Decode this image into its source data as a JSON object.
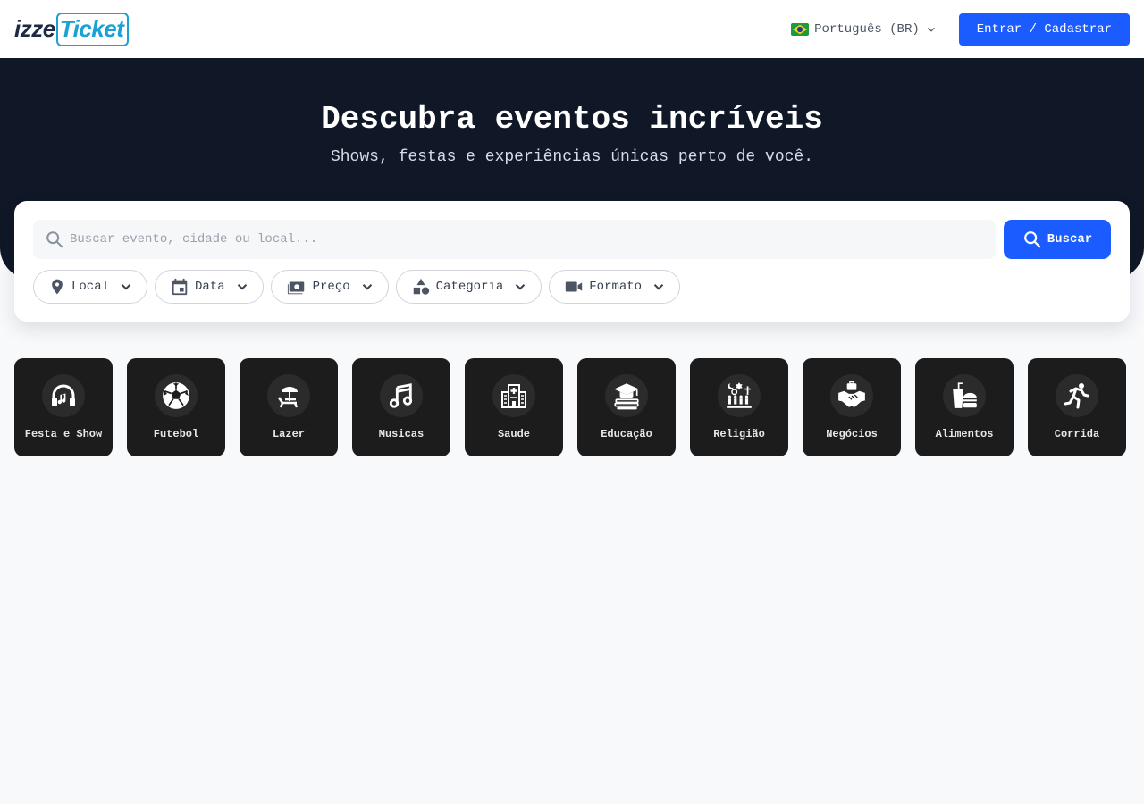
{
  "header": {
    "logo_left": "izze",
    "logo_right": "Ticket",
    "language": "Português (BR)",
    "login_button": "Entrar / Cadastrar"
  },
  "hero": {
    "title": "Descubra eventos incríveis",
    "subtitle": "Shows, festas e experiências únicas perto de você."
  },
  "search": {
    "placeholder": "Buscar evento, cidade ou local...",
    "button": "Buscar"
  },
  "filters": [
    {
      "label": "Local",
      "icon": "map-pin-icon"
    },
    {
      "label": "Data",
      "icon": "calendar-icon"
    },
    {
      "label": "Preço",
      "icon": "money-icon"
    },
    {
      "label": "Categoria",
      "icon": "shapes-icon"
    },
    {
      "label": "Formato",
      "icon": "video-camera-icon"
    }
  ],
  "categories": [
    {
      "label": "Festa e Show",
      "icon": "headphones-icon"
    },
    {
      "label": "Futebol",
      "icon": "soccer-ball-icon"
    },
    {
      "label": "Lazer",
      "icon": "beach-chair-icon"
    },
    {
      "label": "Musicas",
      "icon": "music-note-icon"
    },
    {
      "label": "Saude",
      "icon": "hospital-icon"
    },
    {
      "label": "Educação",
      "icon": "graduation-cap-icon"
    },
    {
      "label": "Religião",
      "icon": "religion-icon"
    },
    {
      "label": "Negócios",
      "icon": "handshake-icon"
    },
    {
      "label": "Alimentos",
      "icon": "fast-food-icon"
    },
    {
      "label": "Corrida",
      "icon": "runner-icon"
    }
  ],
  "colors": {
    "primary": "#1a5cff",
    "hero_bg": "#101828",
    "card_bg": "#1c1c1c",
    "page_bg": "#f8f9fb",
    "logo_dark": "#1e2a44",
    "logo_accent": "#1ba1d4"
  }
}
